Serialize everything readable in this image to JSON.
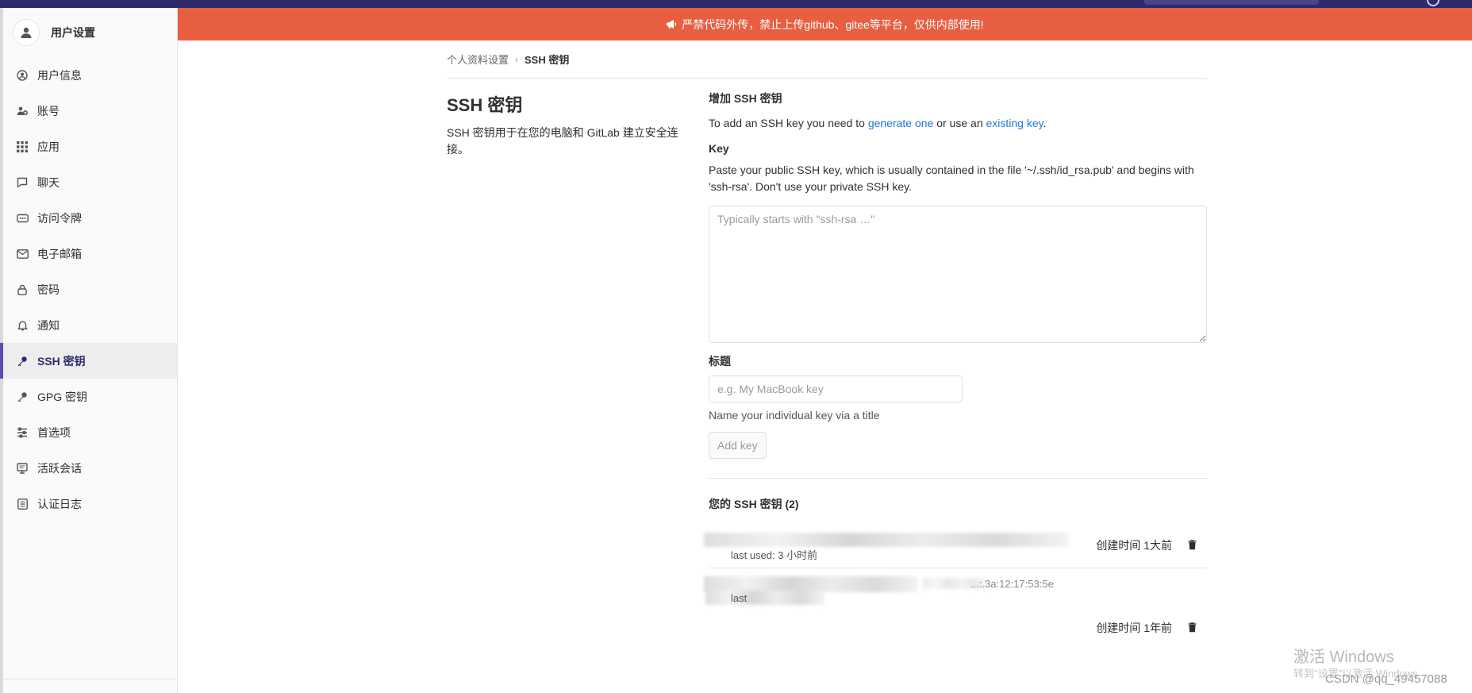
{
  "sidebar": {
    "title": "用户设置",
    "items": [
      {
        "label": "用户信息",
        "icon": "profile-icon"
      },
      {
        "label": "账号",
        "icon": "account-icon"
      },
      {
        "label": "应用",
        "icon": "applications-icon"
      },
      {
        "label": "聊天",
        "icon": "chat-icon"
      },
      {
        "label": "访问令牌",
        "icon": "token-icon"
      },
      {
        "label": "电子邮箱",
        "icon": "mail-icon"
      },
      {
        "label": "密码",
        "icon": "lock-icon"
      },
      {
        "label": "通知",
        "icon": "bell-icon"
      },
      {
        "label": "SSH 密钥",
        "icon": "key-icon",
        "active": true
      },
      {
        "label": "GPG 密钥",
        "icon": "key-icon"
      },
      {
        "label": "首选项",
        "icon": "preferences-icon"
      },
      {
        "label": "活跃会话",
        "icon": "monitor-icon"
      },
      {
        "label": "认证日志",
        "icon": "log-icon"
      }
    ]
  },
  "banner": {
    "text": "严禁代码外传，禁止上传github、gitee等平台，仅供内部使用!",
    "color": "#e75e40"
  },
  "breadcrumb": {
    "parent": "个人资料设置",
    "current": "SSH 密钥"
  },
  "intro": {
    "title": "SSH 密钥",
    "description": "SSH 密钥用于在您的电脑和 GitLab 建立安全连接。"
  },
  "add_key": {
    "heading": "增加 SSH 密钥",
    "text_before": "To add an SSH key you need to ",
    "link_generate": "generate one",
    "text_middle": " or use an ",
    "link_existing": "existing key",
    "text_after": ".",
    "key_label": "Key",
    "key_help": "Paste your public SSH key, which is usually contained in the file '~/.ssh/id_rsa.pub' and begins with 'ssh-rsa'. Don't use your private SSH key.",
    "key_placeholder": "Typically starts with \"ssh-rsa …\"",
    "title_label": "标题",
    "title_placeholder": "e.g. My MacBook key",
    "title_help": "Name your individual key via a title",
    "button": "Add key"
  },
  "your_keys": {
    "heading": "您的 SSH 密钥 (2)",
    "keys": [
      {
        "last_used": "last used: 3 小时前",
        "created": "创建时间 1大前",
        "fingerprint_fragment": ""
      },
      {
        "last_used": "last",
        "created": "创建时间 1年前",
        "fingerprint_fragment": "...:.3a:12:17:53:5e"
      }
    ]
  },
  "watermark": {
    "line1": "激活 Windows",
    "line2": "转到\"设置\"以激活 Windows",
    "credit": "CSDN @qq_49457088"
  }
}
